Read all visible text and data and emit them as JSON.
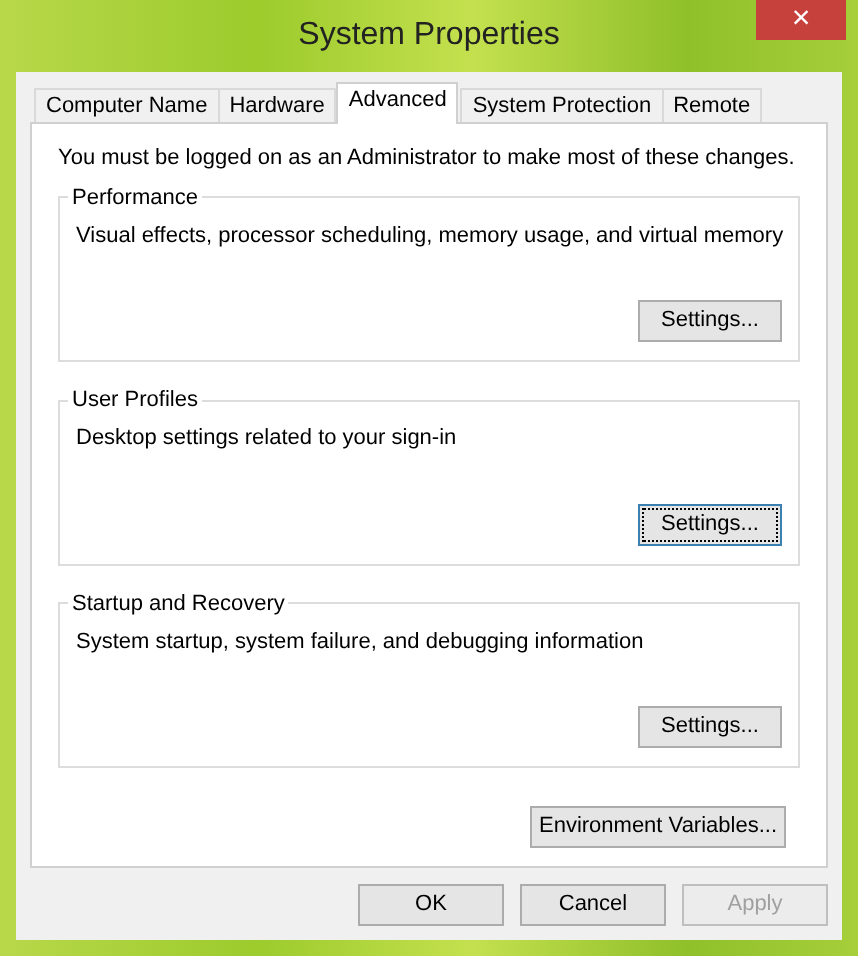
{
  "window": {
    "title": "System Properties",
    "close": "×"
  },
  "tabs": [
    {
      "label": "Computer Name",
      "selected": false
    },
    {
      "label": "Hardware",
      "selected": false
    },
    {
      "label": "Advanced",
      "selected": true
    },
    {
      "label": "System Protection",
      "selected": false
    },
    {
      "label": "Remote",
      "selected": false
    }
  ],
  "notice": "You must be logged on as an Administrator to make most of these changes.",
  "groups": [
    {
      "title": "Performance",
      "description": "Visual effects, processor scheduling, memory usage, and virtual memory",
      "button": {
        "label": "Settings...",
        "focused": false
      }
    },
    {
      "title": "User Profiles",
      "description": "Desktop settings related to your sign-in",
      "button": {
        "label": "Settings...",
        "focused": true
      }
    },
    {
      "title": "Startup and Recovery",
      "description": "System startup, system failure, and debugging information",
      "button": {
        "label": "Settings...",
        "focused": false
      }
    }
  ],
  "environment_button": {
    "label": "Environment Variables...",
    "focused": false
  },
  "buttons": [
    {
      "label": "OK",
      "disabled": false
    },
    {
      "label": "Cancel",
      "disabled": false
    },
    {
      "label": "Apply",
      "disabled": true
    }
  ]
}
